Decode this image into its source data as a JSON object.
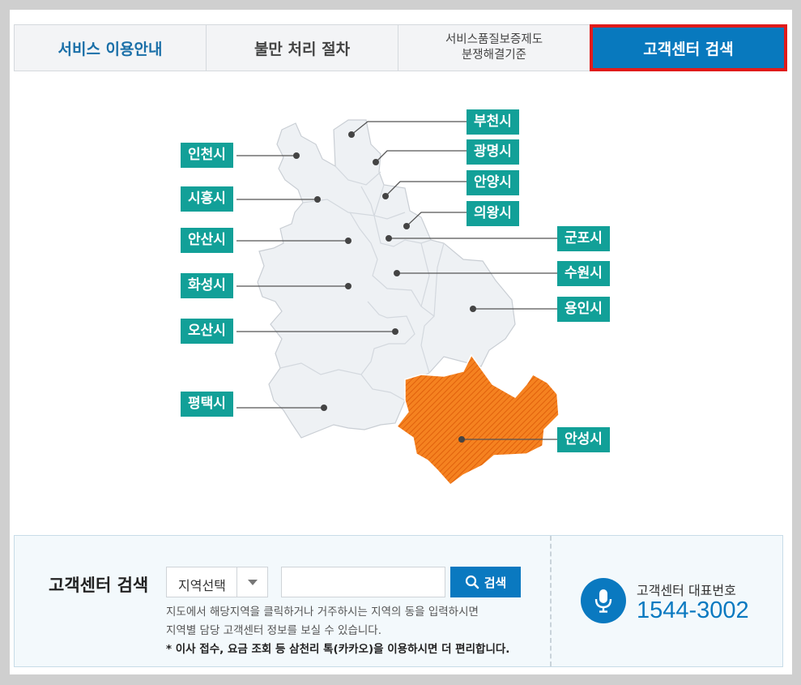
{
  "tabs": [
    {
      "label": "서비스 이용안내",
      "active": false
    },
    {
      "label": "불만 처리 절차",
      "active": false
    },
    {
      "label": "서비스품질보증제도\n분쟁해결기준",
      "active": false
    },
    {
      "label": "고객센터 검색",
      "active": true
    }
  ],
  "map": {
    "cities": {
      "incheon": "인천시",
      "siheung": "시흥시",
      "ansan": "안산시",
      "hwaseong": "화성시",
      "osan": "오산시",
      "pyeongtaek": "평택시",
      "bucheon": "부천시",
      "gwangmyeong": "광명시",
      "anyang": "안양시",
      "uiwang": "의왕시",
      "gunpo": "군포시",
      "suwon": "수원시",
      "yongin": "용인시",
      "anseong": "안성시"
    },
    "highlighted": "안성시",
    "colors": {
      "label_bg": "#12a098",
      "highlight": "#f07a1e",
      "region": "#eef1f4"
    }
  },
  "search": {
    "title": "고객센터 검색",
    "select_value": "지역선택",
    "input_value": "",
    "button_label": "검색",
    "help_line1": "지도에서 해당지역을 클릭하거나 거주하시는 지역의 동을 입력하시면",
    "help_line2": "지역별 담당 고객센터 정보를 보실 수 있습니다.",
    "help_line3": "* 이사 접수, 요금 조회 등 삼천리 톡(카카오)을 이용하시면 더 편리합니다."
  },
  "contact": {
    "label": "고객센터 대표번호",
    "number": "1544-3002",
    "icon": "microphone-icon"
  }
}
